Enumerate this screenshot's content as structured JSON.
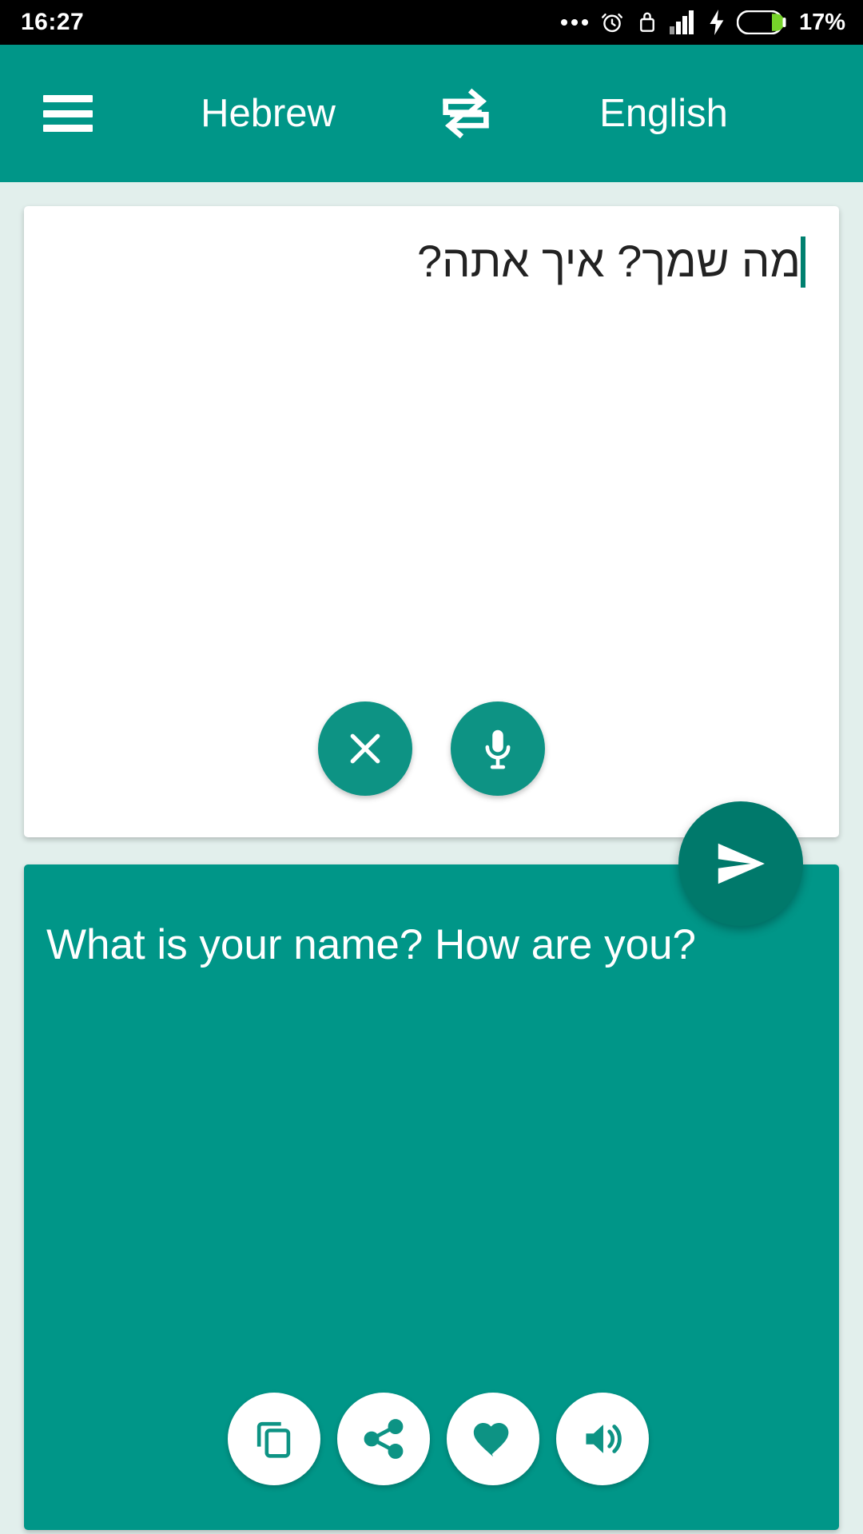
{
  "statusbar": {
    "time": "16:27",
    "battery_percent": "17%",
    "icons": [
      "more-dots-icon",
      "alarm-clock-icon",
      "usb-lock-icon",
      "signal-bars-icon",
      "charging-bolt-icon",
      "battery-icon"
    ]
  },
  "appbar": {
    "menu_icon": "hamburger-menu-icon",
    "source_language": "Hebrew",
    "swap_icon": "swap-languages-icon",
    "target_language": "English",
    "background_color": "#009688"
  },
  "input_card": {
    "text": "מה שמך? איך אתה?",
    "has_caret": true,
    "caret_color": "#00806f",
    "background_color": "#ffffff",
    "actions": [
      {
        "name": "clear-button",
        "icon": "close-x-icon",
        "label": "Clear"
      },
      {
        "name": "mic-button",
        "icon": "microphone-icon",
        "label": "Speak"
      }
    ]
  },
  "send_button": {
    "icon": "send-plane-icon",
    "label": "Translate",
    "color": "#00796b"
  },
  "result_card": {
    "text": "What is your name? How are you?",
    "background_color": "#009688",
    "text_color": "#ffffff",
    "actions": [
      {
        "name": "copy-button",
        "icon": "copy-icon",
        "label": "Copy"
      },
      {
        "name": "share-button",
        "icon": "share-icon",
        "label": "Share"
      },
      {
        "name": "favorite-button",
        "icon": "heart-icon",
        "label": "Favorite"
      },
      {
        "name": "speak-button",
        "icon": "volume-speaker-icon",
        "label": "Listen"
      }
    ]
  }
}
